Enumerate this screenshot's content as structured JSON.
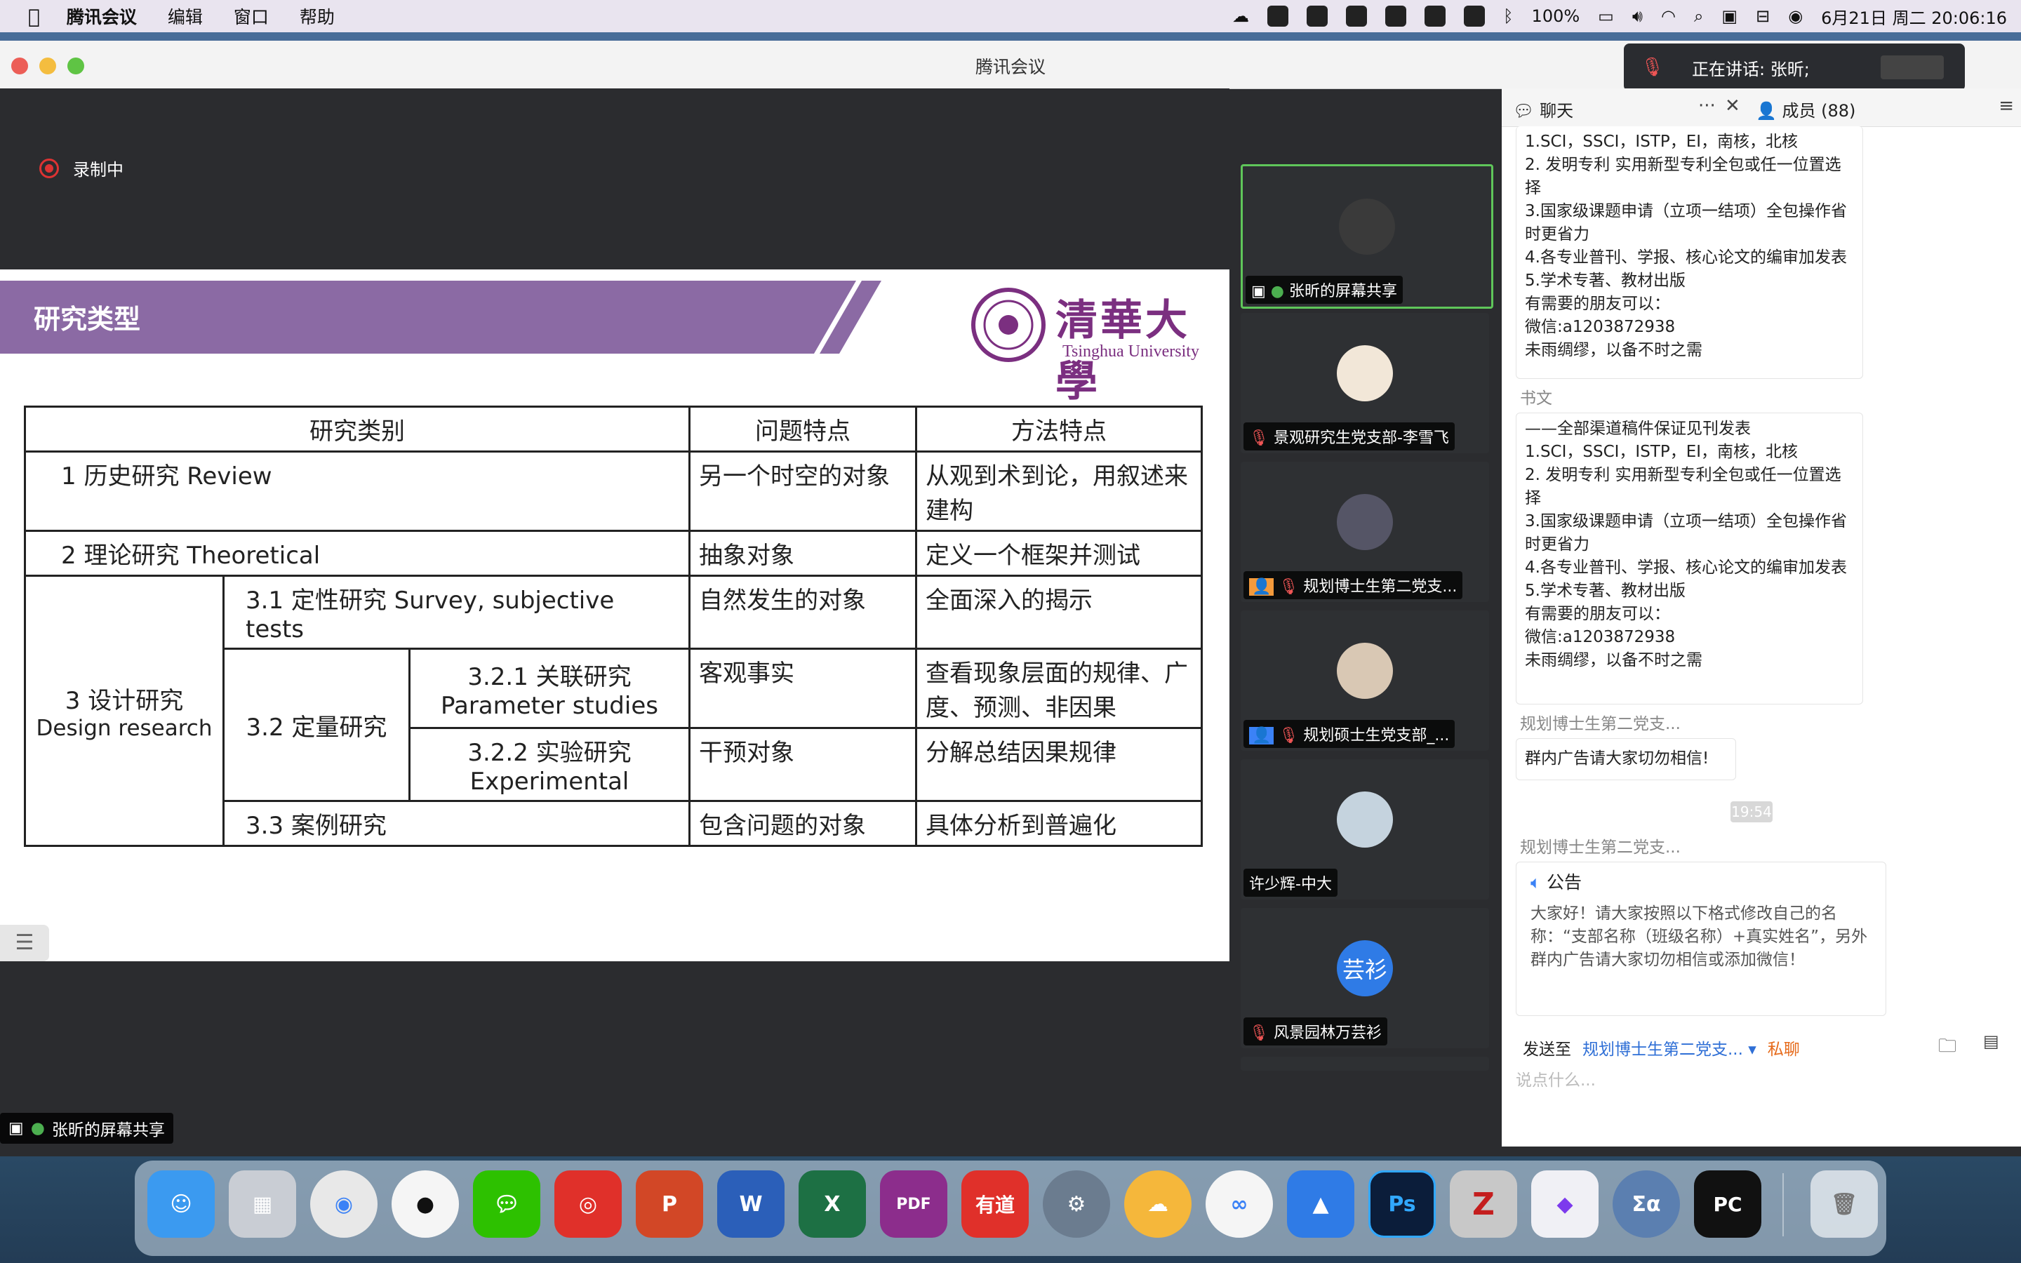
{
  "menubar": {
    "app": "腾讯会议",
    "items": [
      "编辑",
      "窗口",
      "帮助"
    ],
    "battery": "100%",
    "datetime": "6月21日 周二 20:06:16"
  },
  "window": {
    "title": "腾讯会议"
  },
  "toast": {
    "text": "正在讲话: 张昕;"
  },
  "recording": {
    "label": "录制中"
  },
  "slide": {
    "title": "研究类型",
    "logo_text": "清華大學",
    "logo_sub": "Tsinghua University",
    "headers": [
      "研究类别",
      "问题特点",
      "方法特点"
    ],
    "rows": {
      "r1": {
        "cat": "1 历史研究  Review",
        "q": "另一个时空的对象",
        "m": "从观到术到论，用叙述来建构"
      },
      "r2": {
        "cat": "2 理论研究  Theoretical",
        "q": "抽象对象",
        "m": "定义一个框架并测试"
      },
      "r3": {
        "cat": "3 设计研究",
        "cat_en": "Design research"
      },
      "r31": {
        "cat": "3.1 定性研究  Survey, subjective tests",
        "q": "自然发生的对象",
        "m": "全面深入的揭示"
      },
      "r32": {
        "cat": "3.2 定量研究"
      },
      "r321": {
        "cat": "3.2.1 关联研究",
        "cat_en": "Parameter studies",
        "q": "客观事实",
        "m": "查看现象层面的规律、广度、预测、非因果"
      },
      "r322": {
        "cat": "3.2.2 实验研究",
        "cat_en": "Experimental",
        "q": "干预对象",
        "m": "分解总结因果规律"
      },
      "r33": {
        "cat": "3.3 案例研究",
        "q": "包含问题的对象",
        "m": "具体分析到普遍化"
      }
    }
  },
  "share_label": "张昕的屏幕共享",
  "participants": [
    {
      "name": "张昕的屏幕共享"
    },
    {
      "name": "景观研究生党支部-李雪飞"
    },
    {
      "name": "规划博士生第二党支..."
    },
    {
      "name": "规划硕士生党支部_..."
    },
    {
      "name": "许少辉-中大"
    },
    {
      "name": "风景园林万芸衫",
      "avatar_text": "芸衫"
    }
  ],
  "tabs": {
    "chat": "聊天",
    "members": "成员 (88)"
  },
  "chat": {
    "msg1_lines": [
      "1.SCI，SSCI，ISTP，EI，南核，北核",
      "2. 发明专利 实用新型专利全包或任一位置选择",
      "3.国家级课题申请（立项一结项）全包操作省时更省力",
      "4.各专业普刊、学报、核心论文的编审加发表",
      "5.学术专著、教材出版",
      "有需要的朋友可以：",
      "微信:a1203872938",
      "未雨绸缪，以备不时之需"
    ],
    "sender2": "书文",
    "msg2_lines": [
      "——全部渠道稿件保证见刊发表",
      "1.SCI，SSCI，ISTP，EI，南核，北核",
      "2. 发明专利 实用新型专利全包或任一位置选择",
      "3.国家级课题申请（立项一结项）全包操作省时更省力",
      "4.各专业普刊、学报、核心论文的编审加发表",
      "5.学术专著、教材出版",
      "有需要的朋友可以：",
      "微信:a1203872938",
      "未雨绸缪，以备不时之需"
    ],
    "sender3": "规划博士生第二党支...",
    "msg3": "群内广告请大家切勿相信!",
    "time": "19:54",
    "sender4": "规划博士生第二党支...",
    "notice_title": "公告",
    "notice_body": "大家好！请大家按照以下格式修改自己的名称：“支部名称（班级名称）+真实姓名”，另外群内广告请大家切勿相信或添加微信！",
    "send_to_label": "发送至",
    "send_to_target": "规划博士生第二党支...",
    "private": "私聊",
    "input_placeholder": "说点什么..."
  },
  "dock": [
    "Finder",
    "Launchpad",
    "Chrome",
    "QQ",
    "WeChat",
    "NetEase Music",
    "PowerPoint",
    "Word",
    "Excel",
    "PDF",
    "有道",
    "Disk Utility",
    "Weather",
    "Baidu Netdisk",
    "Tencent Meeting",
    "Ps",
    "Zotero",
    "Obsidian",
    "MathType",
    "PC",
    "Trash"
  ]
}
